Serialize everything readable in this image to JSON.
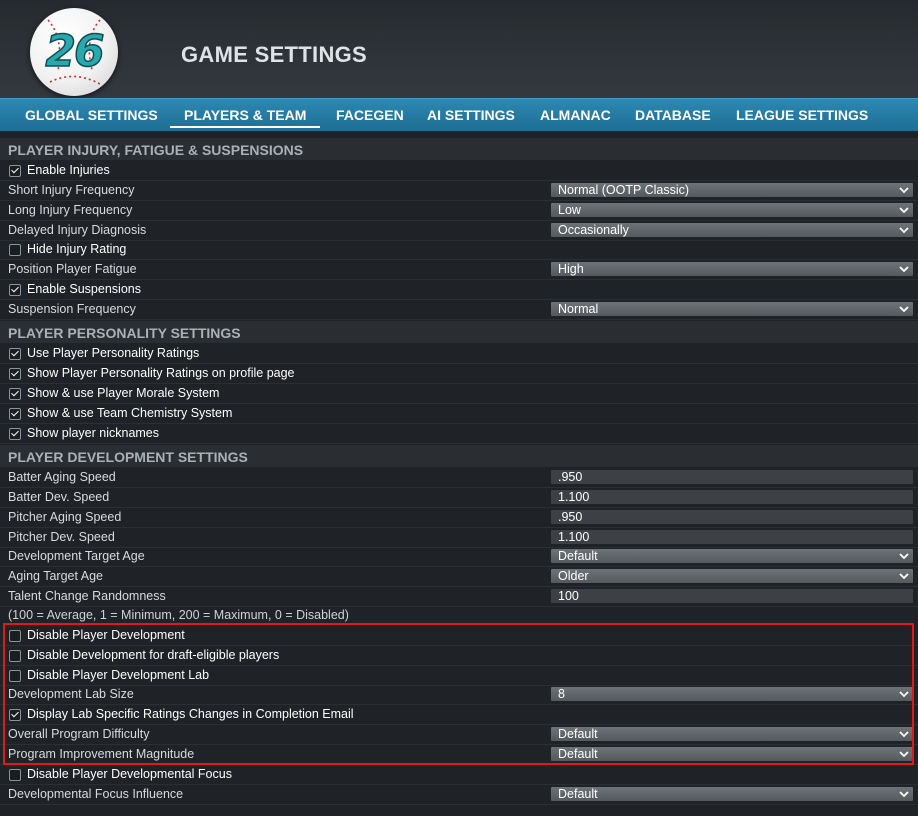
{
  "app": {
    "logo_number": "26",
    "title": "GAME SETTINGS"
  },
  "tabs": [
    {
      "label": "GLOBAL SETTINGS",
      "active": false
    },
    {
      "label": "PLAYERS & TEAM",
      "active": true
    },
    {
      "label": "FACEGEN",
      "active": false
    },
    {
      "label": "AI SETTINGS",
      "active": false
    },
    {
      "label": "ALMANAC",
      "active": false
    },
    {
      "label": "DATABASE",
      "active": false
    },
    {
      "label": "LEAGUE SETTINGS",
      "active": false
    }
  ],
  "injury": {
    "header": "PLAYER INJURY, FATIGUE & SUSPENSIONS",
    "enable_injuries": {
      "label": "Enable Injuries",
      "checked": true
    },
    "short_freq": {
      "label": "Short Injury Frequency",
      "value": "Normal (OOTP Classic)"
    },
    "long_freq": {
      "label": "Long Injury Frequency",
      "value": "Low"
    },
    "delayed_diag": {
      "label": "Delayed Injury Diagnosis",
      "value": "Occasionally"
    },
    "hide_rating": {
      "label": "Hide Injury Rating",
      "checked": false
    },
    "fatigue": {
      "label": "Position Player Fatigue",
      "value": "High"
    },
    "enable_susp": {
      "label": "Enable Suspensions",
      "checked": true
    },
    "susp_freq": {
      "label": "Suspension Frequency",
      "value": "Normal"
    }
  },
  "personality": {
    "header": "PLAYER PERSONALITY SETTINGS",
    "use_ratings": {
      "label": "Use Player Personality Ratings",
      "checked": true
    },
    "show_ratings": {
      "label": "Show Player Personality Ratings on profile page",
      "checked": true
    },
    "morale": {
      "label": "Show & use Player Morale System",
      "checked": true
    },
    "chemistry": {
      "label": "Show & use Team Chemistry System",
      "checked": true
    },
    "nicknames": {
      "label": "Show player nicknames",
      "checked": true
    }
  },
  "development": {
    "header": "PLAYER DEVELOPMENT SETTINGS",
    "batter_aging": {
      "label": "Batter Aging Speed",
      "value": ".950"
    },
    "batter_dev": {
      "label": "Batter Dev. Speed",
      "value": "1.100"
    },
    "pitcher_aging": {
      "label": "Pitcher Aging Speed",
      "value": ".950"
    },
    "pitcher_dev": {
      "label": "Pitcher Dev. Speed",
      "value": "1.100"
    },
    "dev_target_age": {
      "label": "Development Target Age",
      "value": "Default"
    },
    "aging_target_age": {
      "label": "Aging Target Age",
      "value": "Older"
    },
    "talent_random": {
      "label": "Talent Change Randomness",
      "value": "100"
    },
    "talent_note": "(100 = Average, 1 = Minimum, 200 = Maximum, 0 = Disabled)",
    "disable_dev": {
      "label": "Disable Player Development",
      "checked": false
    },
    "disable_draft": {
      "label": "Disable Development for draft-eligible players",
      "checked": false
    },
    "disable_lab": {
      "label": "Disable Player Development Lab",
      "checked": false
    },
    "lab_size": {
      "label": "Development Lab Size",
      "value": "8"
    },
    "lab_email": {
      "label": "Display Lab Specific Ratings Changes in Completion Email",
      "checked": true
    },
    "program_difficulty": {
      "label": "Overall Program Difficulty",
      "value": "Default"
    },
    "program_magnitude": {
      "label": "Program Improvement Magnitude",
      "value": "Default"
    },
    "disable_focus": {
      "label": "Disable Player Developmental Focus",
      "checked": false
    },
    "focus_influence": {
      "label": "Developmental Focus Influence",
      "value": "Default"
    }
  },
  "colors": {
    "accent": "#2a86b0",
    "highlight_border": "#e0181b",
    "background": "#1f2226"
  }
}
